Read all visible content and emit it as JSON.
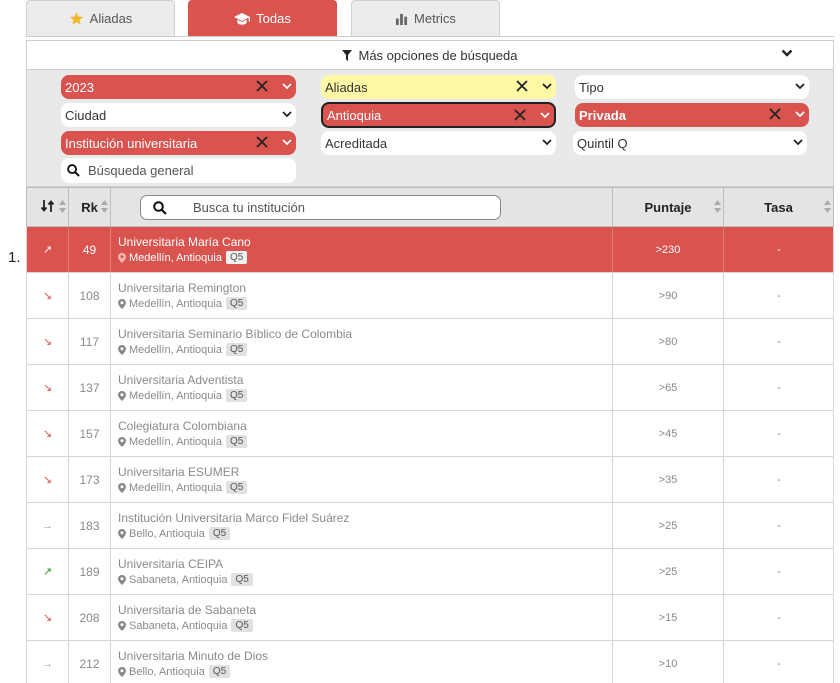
{
  "tabs": [
    {
      "label": "Aliadas",
      "icon": "star-icon",
      "active": false
    },
    {
      "label": "Todas",
      "icon": "graduation-cap-icon",
      "active": true
    },
    {
      "label": "Metrics",
      "icon": "bar-chart-icon",
      "active": false
    }
  ],
  "filters": {
    "more_options_label": "Más opciones de búsqueda",
    "year": "2023",
    "aliadas": "Aliadas",
    "tipo": "Tipo",
    "ciudad": "Ciudad",
    "departamento": "Antioquia",
    "sector": "Privada",
    "caracter": "Institución universitaria",
    "acreditada": "Acreditada",
    "quintil": "Quintil Q",
    "general_search_placeholder": "Búsqueda general"
  },
  "table": {
    "headers": {
      "rk": "Rk",
      "score": "Puntaje",
      "rate": "Tasa"
    },
    "search_placeholder": "Busca tu institución",
    "first_row_number": "1.",
    "rows": [
      {
        "trend": "↗",
        "rk": "49",
        "name": "Universitaria María Cano",
        "location": "Medellín, Antioquia",
        "quintile": "Q5",
        "score": ">230",
        "rate": "-"
      },
      {
        "trend": "↘",
        "rk": "108",
        "name": "Universitaria Remington",
        "location": "Medellín, Antioquia",
        "quintile": "Q5",
        "score": ">90",
        "rate": "-"
      },
      {
        "trend": "↘",
        "rk": "117",
        "name": "Universitaria Seminario Bíblico de Colombia",
        "location": "Medellín, Antioquia",
        "quintile": "Q5",
        "score": ">80",
        "rate": "-"
      },
      {
        "trend": "↘",
        "rk": "137",
        "name": "Universitaria Adventista",
        "location": "Medellín, Antioquia",
        "quintile": "Q5",
        "score": ">65",
        "rate": "-"
      },
      {
        "trend": "↘",
        "rk": "157",
        "name": "Colegiatura Colombiana",
        "location": "Medellín, Antioquia",
        "quintile": "Q5",
        "score": ">45",
        "rate": "-"
      },
      {
        "trend": "↘",
        "rk": "173",
        "name": "Universitaria ESUMER",
        "location": "Medellín, Antioquia",
        "quintile": "Q5",
        "score": ">35",
        "rate": "-"
      },
      {
        "trend": "→",
        "rk": "183",
        "name": "Institución Universitaria Marco Fidel Suárez",
        "location": "Bello, Antioquia",
        "quintile": "Q5",
        "score": ">25",
        "rate": "-"
      },
      {
        "trend": "↗",
        "rk": "189",
        "name": "Universitaria CEIPA",
        "location": "Sabaneta, Antioquia",
        "quintile": "Q5",
        "score": ">25",
        "rate": "-"
      },
      {
        "trend": "↘",
        "rk": "208",
        "name": "Universitaria de Sabaneta",
        "location": "Sabaneta, Antioquia",
        "quintile": "Q5",
        "score": ">15",
        "rate": "-"
      },
      {
        "trend": "→",
        "rk": "212",
        "name": "Universitaria Minuto de Dios",
        "location": "Bello, Antioquia",
        "quintile": "Q5",
        "score": ">10",
        "rate": "-"
      }
    ]
  },
  "colors": {
    "accent_red": "#d9534f",
    "highlight_yellow": "#fff9a6",
    "trend_up": "#2e9a2e",
    "trend_down": "#d9534f",
    "trend_flat": "#999999"
  }
}
